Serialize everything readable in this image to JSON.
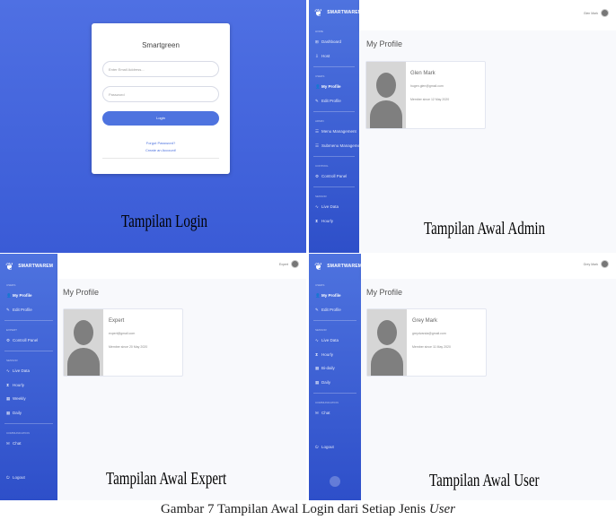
{
  "login": {
    "title": "Smartgreen",
    "email_placeholder": "Enter Email Address...",
    "password_placeholder": "Password",
    "login_button": "Login",
    "forgot_link": "Forgot Password?",
    "create_link": "Create an Account!",
    "caption": "Tampilan Login"
  },
  "admin": {
    "brand": "SMARTWAREM",
    "topbar_user": "Glen Mark",
    "sidebar": [
      {
        "type": "head",
        "label": "Home"
      },
      {
        "type": "item",
        "icon": "⊞",
        "label": "Dashboard"
      },
      {
        "type": "item",
        "icon": "⇩",
        "label": "Host"
      },
      {
        "type": "sep"
      },
      {
        "type": "head",
        "label": "Users"
      },
      {
        "type": "item",
        "icon": "👤",
        "label": "My Profile",
        "active": true
      },
      {
        "type": "item",
        "icon": "✎",
        "label": "Edit Profile"
      },
      {
        "type": "sep"
      },
      {
        "type": "head",
        "label": "Admin"
      },
      {
        "type": "item",
        "icon": "☰",
        "label": "Menu Management"
      },
      {
        "type": "item",
        "icon": "☰",
        "label": "Submenu Management"
      },
      {
        "type": "sep"
      },
      {
        "type": "head",
        "label": "Control"
      },
      {
        "type": "item",
        "icon": "⚙",
        "label": "Controll Panel"
      },
      {
        "type": "sep"
      },
      {
        "type": "head",
        "label": "Sensor"
      },
      {
        "type": "item",
        "icon": "∿",
        "label": "Live Data"
      },
      {
        "type": "item",
        "icon": "⧗",
        "label": "Hourly"
      }
    ],
    "page_title": "My Profile",
    "profile": {
      "name": "Glen Mark",
      "email": "hugen.glen@gmail.com",
      "since": "Member since 12 May 2020"
    },
    "caption": "Tampilan Awal Admin"
  },
  "expert": {
    "brand": "SMARTWAREM",
    "topbar_user": "Expert",
    "sidebar": [
      {
        "type": "head",
        "label": "Users"
      },
      {
        "type": "item",
        "icon": "👤",
        "label": "My Profile",
        "active": true
      },
      {
        "type": "item",
        "icon": "✎",
        "label": "Edit Profile"
      },
      {
        "type": "sep"
      },
      {
        "type": "head",
        "label": "Expert"
      },
      {
        "type": "item",
        "icon": "⚙",
        "label": "Controll Panel"
      },
      {
        "type": "sep"
      },
      {
        "type": "head",
        "label": "Sensor"
      },
      {
        "type": "item",
        "icon": "∿",
        "label": "Live Data"
      },
      {
        "type": "item",
        "icon": "⧗",
        "label": "Hourly"
      },
      {
        "type": "item",
        "icon": "▦",
        "label": "Weekly"
      },
      {
        "type": "item",
        "icon": "▦",
        "label": "Daily"
      },
      {
        "type": "sep"
      },
      {
        "type": "head",
        "label": "Communication"
      },
      {
        "type": "item",
        "icon": "✉",
        "label": "Chat"
      },
      {
        "type": "spacer"
      },
      {
        "type": "item",
        "icon": "⏻",
        "label": "Logout"
      }
    ],
    "page_title": "My Profile",
    "profile": {
      "name": "Expert",
      "email": "expert@gmail.com",
      "since": "Member since 20 May 2020"
    },
    "caption": "Tampilan Awal Expert"
  },
  "user": {
    "brand": "SMARTWAREM",
    "topbar_user": "Grey Mark",
    "sidebar": [
      {
        "type": "head",
        "label": "Users"
      },
      {
        "type": "item",
        "icon": "👤",
        "label": "My Profile",
        "active": true
      },
      {
        "type": "item",
        "icon": "✎",
        "label": "Edit Profile"
      },
      {
        "type": "sep"
      },
      {
        "type": "head",
        "label": "Sensor"
      },
      {
        "type": "item",
        "icon": "∿",
        "label": "Live Data"
      },
      {
        "type": "item",
        "icon": "⧗",
        "label": "Hourly"
      },
      {
        "type": "item",
        "icon": "▦",
        "label": "Bi-daily"
      },
      {
        "type": "item",
        "icon": "▦",
        "label": "Daily"
      },
      {
        "type": "sep"
      },
      {
        "type": "head",
        "label": "Communication"
      },
      {
        "type": "item",
        "icon": "✉",
        "label": "Chat"
      },
      {
        "type": "spacer"
      },
      {
        "type": "item",
        "icon": "⏻",
        "label": "Logout"
      }
    ],
    "page_title": "My Profile",
    "profile": {
      "name": "Grey Mark",
      "email": "greydvanda@gmail.com",
      "since": "Member since 11 May 2020"
    },
    "caption": "Tampilan Awal User"
  },
  "figure_caption": {
    "prefix": "Gambar 7 Tampilan Awal Login dari Setiap Jenis ",
    "italic": "User"
  }
}
